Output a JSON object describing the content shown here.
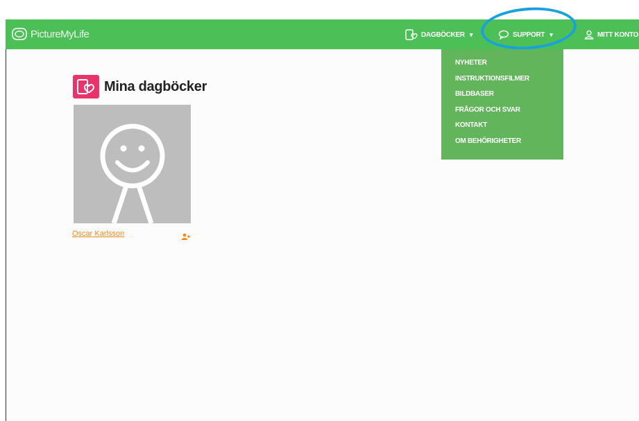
{
  "app": {
    "brand_name": "PictureMyLife"
  },
  "nav": {
    "items": [
      {
        "label": "DAGBÖCKER",
        "icon": "diary-heart-icon",
        "has_caret": true
      },
      {
        "label": "SUPPORT",
        "icon": "speech-bubble-icon",
        "has_caret": true
      },
      {
        "label": "MITT KONTO",
        "icon": "user-icon",
        "has_caret": false
      }
    ]
  },
  "support_menu": {
    "items": [
      "NYHETER",
      "INSTRUKTIONSFILMER",
      "BILDBASER",
      "FRÅGOR OCH SVAR",
      "KONTAKT",
      "OM BEHÖRIGHETER"
    ]
  },
  "page": {
    "title": "Mina dagböcker"
  },
  "diaries": [
    {
      "name": "Oscar Karlsson",
      "avatar": "smiley-stick-figure",
      "share_icon": "share-users-icon"
    }
  ],
  "colors": {
    "navbar": "#4dbf57",
    "dropdown": "#63b55b",
    "highlight_ring": "#1aa1dc",
    "heading_icon": "#e8336b",
    "link": "#ec8c1f",
    "avatar_bg": "#bdbdbd"
  },
  "caret_glyph": "▾"
}
